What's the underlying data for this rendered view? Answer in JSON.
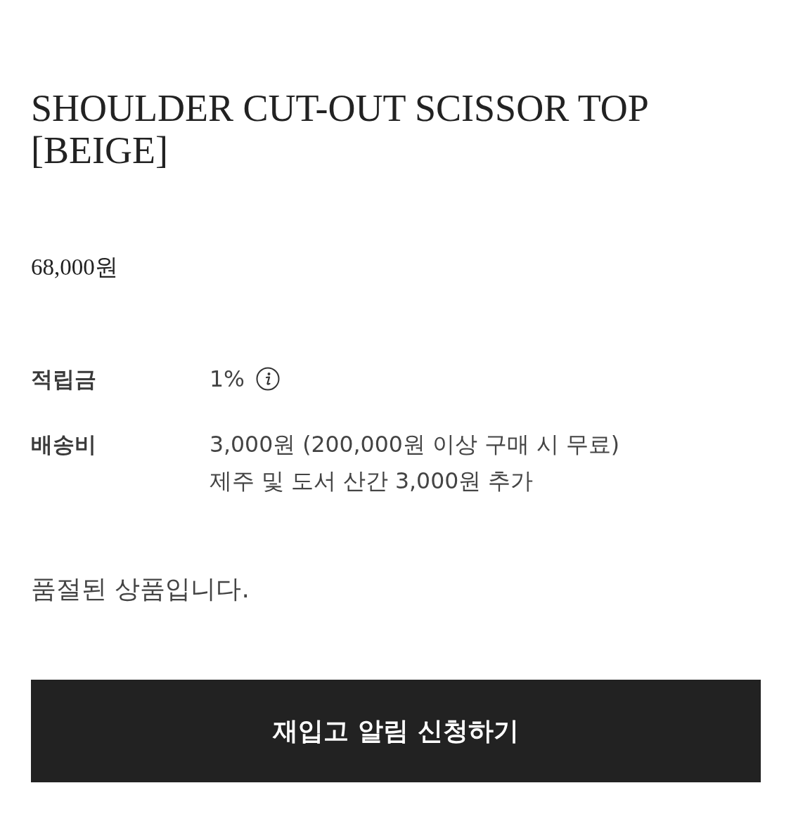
{
  "product": {
    "title": "SHOULDER CUT-OUT SCISSOR TOP [BEIGE]",
    "price": "68,000원"
  },
  "details": [
    {
      "label": "적립금",
      "lines": [
        "1%"
      ],
      "info_icon": true
    },
    {
      "label": "배송비",
      "lines": [
        "3,000원 (200,000원 이상 구매 시 무료)",
        "제주 및 도서 산간 3,000원 추가"
      ]
    }
  ],
  "notice": "품절된 상품입니다.",
  "button": {
    "label": "재입고 알림 신청하기"
  }
}
